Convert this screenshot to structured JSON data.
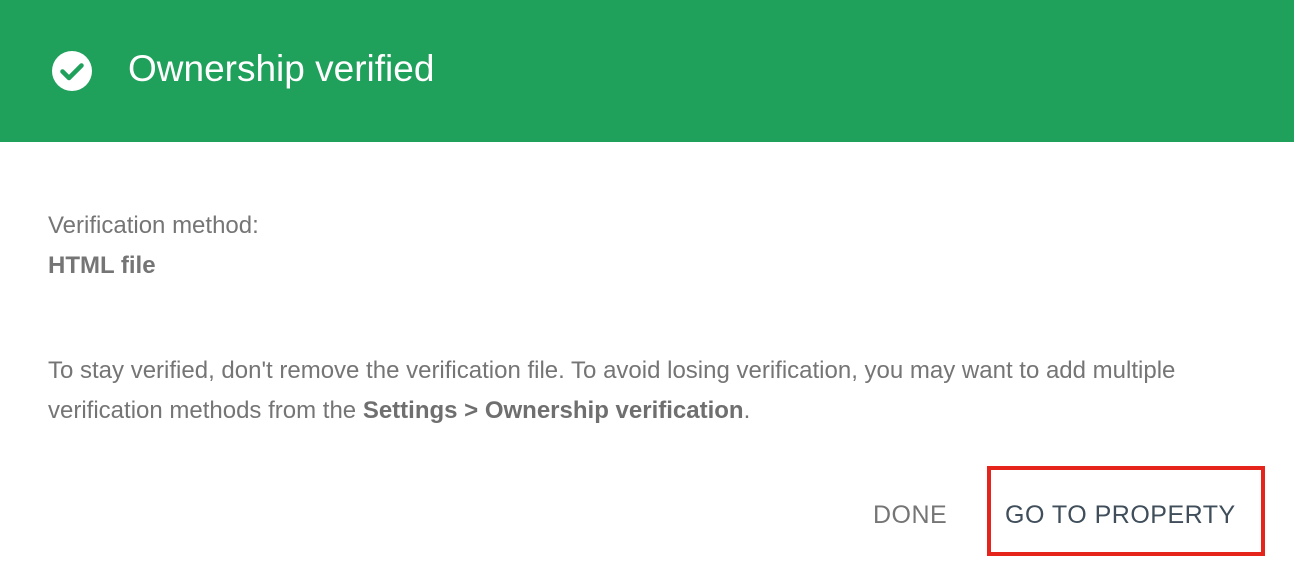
{
  "header": {
    "title": "Ownership verified",
    "icon": "check-circle-icon",
    "background_color": "#1fa05b"
  },
  "body": {
    "method_label": "Verification method:",
    "method_value": "HTML file",
    "note_part1": "To stay verified, don't remove the verification file. To avoid losing verification, you may want to add multiple verification methods from the ",
    "note_bold": "Settings > Ownership verification",
    "note_part2": "."
  },
  "actions": {
    "done_label": "DONE",
    "go_to_property_label": "GO TO PROPERTY"
  },
  "highlight": {
    "color": "#e5241b",
    "target": "go-to-property-button"
  }
}
